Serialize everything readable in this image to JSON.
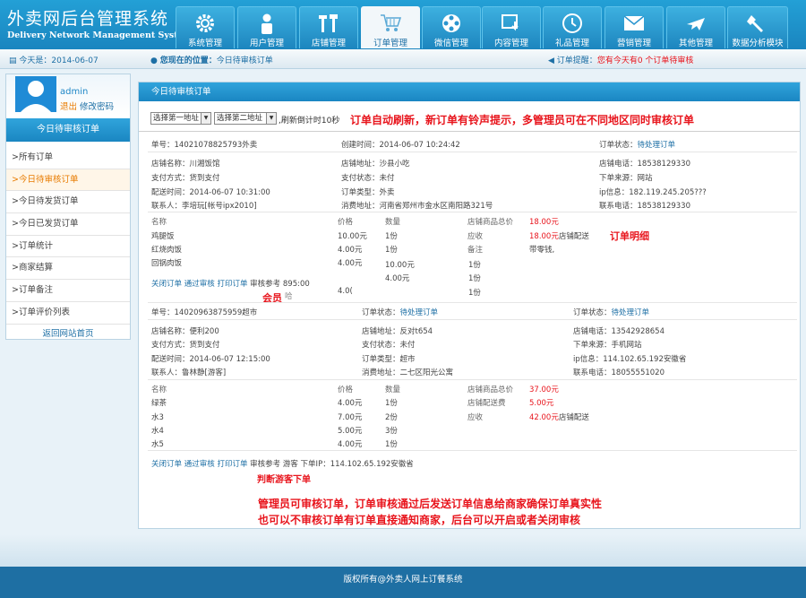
{
  "app": {
    "title_cn": "外卖网后台管理系统",
    "title_en": "Delivery Network Management System"
  },
  "nav": [
    {
      "label": "系统管理",
      "icon": "gear"
    },
    {
      "label": "用户管理",
      "icon": "user"
    },
    {
      "label": "店铺管理",
      "icon": "tools"
    },
    {
      "label": "订单管理",
      "icon": "cart"
    },
    {
      "label": "微信管理",
      "icon": "film"
    },
    {
      "label": "内容管理",
      "icon": "download"
    },
    {
      "label": "礼品管理",
      "icon": "clock"
    },
    {
      "label": "营销管理",
      "icon": "mail"
    },
    {
      "label": "其他管理",
      "icon": "plane"
    },
    {
      "label": "数据分析模块",
      "icon": "wrench"
    }
  ],
  "status": {
    "today": "今天是：2014-06-07",
    "location_label": "您现在的位置：",
    "location": "今日待审核订单",
    "reminder_label": "订单提醒：",
    "reminder": "您有今天有0 个订单待审核"
  },
  "sidebar": {
    "user": "admin",
    "logout": "退出",
    "change_pwd": "修改密码",
    "title": "今日待审核订单",
    "items": [
      ">所有订单",
      ">今日待审核订单",
      ">今日待发货订单",
      ">今日已发货订单",
      ">订单统计",
      ">商家结算",
      ">订单备注",
      ">订单评价列表"
    ],
    "back": "返回网站首页"
  },
  "main": {
    "title": "今日待审核订单",
    "select1": "选择第一地址",
    "select2": "选择第二地址",
    "refresh": ",刷新倒计时10秒",
    "ann_top": "订单自动刷新，新订单有铃声提示，多管理员可在不同地区同时审核订单",
    "ann_detail": "订单明细",
    "ann_member": "会员",
    "ann_guest": "判断游客下单",
    "ann_bottom1": "管理员可审核订单，订单审核通过后发送订单信息给商家确保订单真实性",
    "ann_bottom2": "也可以不审核订单有订单直接通知商家，后台可以开启或者关闭审核"
  },
  "order1": {
    "no_label": "单号：",
    "no": "14021078825793",
    "no_tag": "外卖",
    "created": "创建时间：2014-06-07 10:24:42",
    "status_label": "订单状态：",
    "status": "待处理订单",
    "shop": "店铺名称：川湘饭馆",
    "shop_addr": "店铺地址：沙县小吃",
    "shop_tel": "店铺电话：18538129330",
    "pay_method": "支付方式：货到支付",
    "pay_status": "支付状态：未付",
    "source": "下单来源：网站",
    "delivery": "配送时间：2014-06-07 10:31:00",
    "type": "订单类型：外卖",
    "ip": "ip信息：182.119.245.205???",
    "contact": "联系人：李培玩[帐号ipx2010]",
    "address": "消费地址：河南省郑州市金水区南阳路321号",
    "phone": "联系电话：18538129330",
    "h_name": "名称",
    "h_price": "价格",
    "h_qty": "数量",
    "items": [
      {
        "name": "鸡腿饭",
        "price": "10.00元",
        "qty": "1份"
      },
      {
        "name": "红烧肉饭",
        "price": "4.00元",
        "qty": "1份"
      },
      {
        "name": "回锅肉饭",
        "price": "4.00元",
        "qty": "1份"
      }
    ],
    "total_label": "店铺商品总价",
    "total": "18.00元",
    "due_label": "应收",
    "due": "18.00元",
    "due_note": "店铺配送",
    "remark_label": "备注",
    "remark": "带零钱,",
    "extra_prices": [
      "10.00元",
      "4.00元",
      "4.0("
    ],
    "extra_qtys": [
      "1份",
      "1份",
      "1份"
    ],
    "actions": [
      "关闭订单",
      "通过审核",
      "打印订单",
      "审核参考"
    ],
    "ref": "895:00",
    "ref_tail": "哈"
  },
  "order2": {
    "no_label": "单号：",
    "no": "14020963875959",
    "no_tag": "超市",
    "status_label": "订单状态：",
    "status": "待处理订单",
    "status2_label": "订单状态：",
    "status2": "待处理订单",
    "shop": "店铺名称：便利200",
    "shop_addr": "店铺地址：反对t654",
    "shop_tel": "店铺电话：13542928654",
    "pay_method": "支付方式：货到支付",
    "pay_status": "支付状态：未付",
    "source": "下单来源：手机网站",
    "delivery": "配送时间：2014-06-07 12:15:00",
    "type": "订单类型：超市",
    "ip": "ip信息：114.102.65.192安徽省",
    "contact": "联系人：鲁林静[游客]",
    "address": "消费地址：二七区阳光公寓",
    "phone": "联系电话：18055551020",
    "h_name": "名称",
    "h_price": "价格",
    "h_qty": "数量",
    "items": [
      {
        "name": "绿茶",
        "price": "4.00元",
        "qty": "1份"
      },
      {
        "name": "水3",
        "price": "7.00元",
        "qty": "2份"
      },
      {
        "name": "水4",
        "price": "5.00元",
        "qty": "3份"
      },
      {
        "name": "水5",
        "price": "4.00元",
        "qty": "1份"
      }
    ],
    "total_label": "店铺商品总价",
    "total": "37.00元",
    "fee_label": "店铺配送费",
    "fee": "5.00元",
    "due_label": "应收",
    "due": "42.00元",
    "due_note": "店铺配送",
    "actions": [
      "关闭订单",
      "通过审核",
      "打印订单"
    ],
    "ref": "审核参考 游客 下单IP：114.102.65.192安徽省"
  },
  "footer": "版权所有@外卖人网上订餐系统",
  "colors": {
    "primary": "#1d86c6",
    "accent": "#e8141c",
    "orange": "#e87b00",
    "nav_active": "#f2f7fa"
  }
}
